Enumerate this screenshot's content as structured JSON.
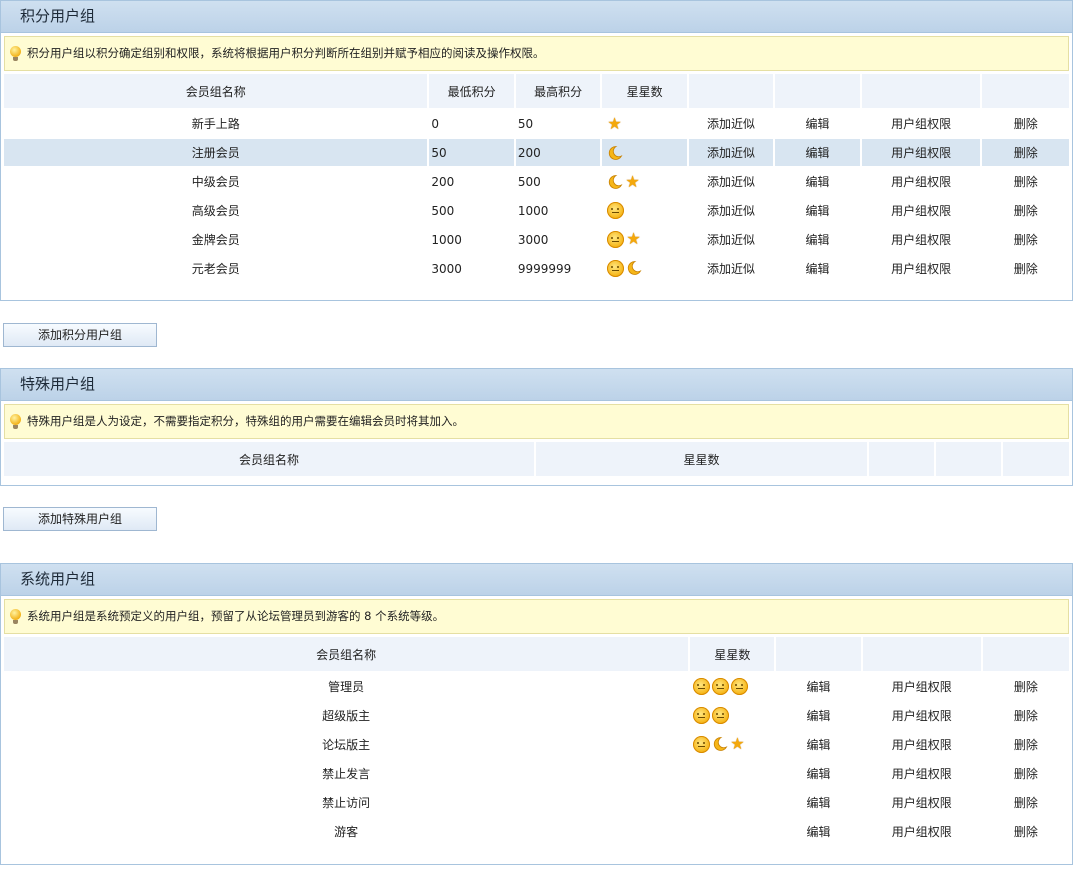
{
  "points_group": {
    "title": "积分用户组",
    "tip": "积分用户组以积分确定组别和权限，系统将根据用户积分判断所在组别并赋予相应的阅读及操作权限。",
    "headers": {
      "name": "会员组名称",
      "min": "最低积分",
      "max": "最高积分",
      "stars": "星星数"
    },
    "actions": {
      "copy": "添加近似",
      "edit": "编辑",
      "perm": "用户组权限",
      "del": "删除"
    },
    "rows": [
      {
        "name": "新手上路",
        "min": "0",
        "max": "50",
        "icons": [
          "star"
        ]
      },
      {
        "name": "注册会员",
        "min": "50",
        "max": "200",
        "icons": [
          "moon"
        ]
      },
      {
        "name": "中级会员",
        "min": "200",
        "max": "500",
        "icons": [
          "moon",
          "star"
        ]
      },
      {
        "name": "高级会员",
        "min": "500",
        "max": "1000",
        "icons": [
          "sun"
        ]
      },
      {
        "name": "金牌会员",
        "min": "1000",
        "max": "3000",
        "icons": [
          "sun",
          "star"
        ]
      },
      {
        "name": "元老会员",
        "min": "3000",
        "max": "9999999",
        "icons": [
          "sun",
          "moon"
        ]
      }
    ],
    "add_button": "添加积分用户组"
  },
  "special_group": {
    "title": "特殊用户组",
    "tip": "特殊用户组是人为设定，不需要指定积分，特殊组的用户需要在编辑会员时将其加入。",
    "headers": {
      "name": "会员组名称",
      "stars": "星星数"
    },
    "add_button": "添加特殊用户组"
  },
  "system_group": {
    "title": "系统用户组",
    "tip": "系统用户组是系统预定义的用户组，预留了从论坛管理员到游客的 8 个系统等级。",
    "headers": {
      "name": "会员组名称",
      "stars": "星星数"
    },
    "actions": {
      "edit": "编辑",
      "perm": "用户组权限",
      "del": "删除"
    },
    "rows": [
      {
        "name": "管理员",
        "icons": [
          "sun",
          "sun",
          "sun"
        ]
      },
      {
        "name": "超级版主",
        "icons": [
          "sun",
          "sun"
        ]
      },
      {
        "name": "论坛版主",
        "icons": [
          "sun",
          "moon",
          "star"
        ]
      },
      {
        "name": "禁止发言",
        "icons": []
      },
      {
        "name": "禁止访问",
        "icons": []
      },
      {
        "name": "游客",
        "icons": []
      }
    ]
  },
  "colors": {
    "header_bg": "#bcd2e8",
    "tip_bg": "#fffcd3",
    "row_highlight": "#d8e5f1",
    "link": "#1b3d6b",
    "star": "#f4a80c"
  }
}
